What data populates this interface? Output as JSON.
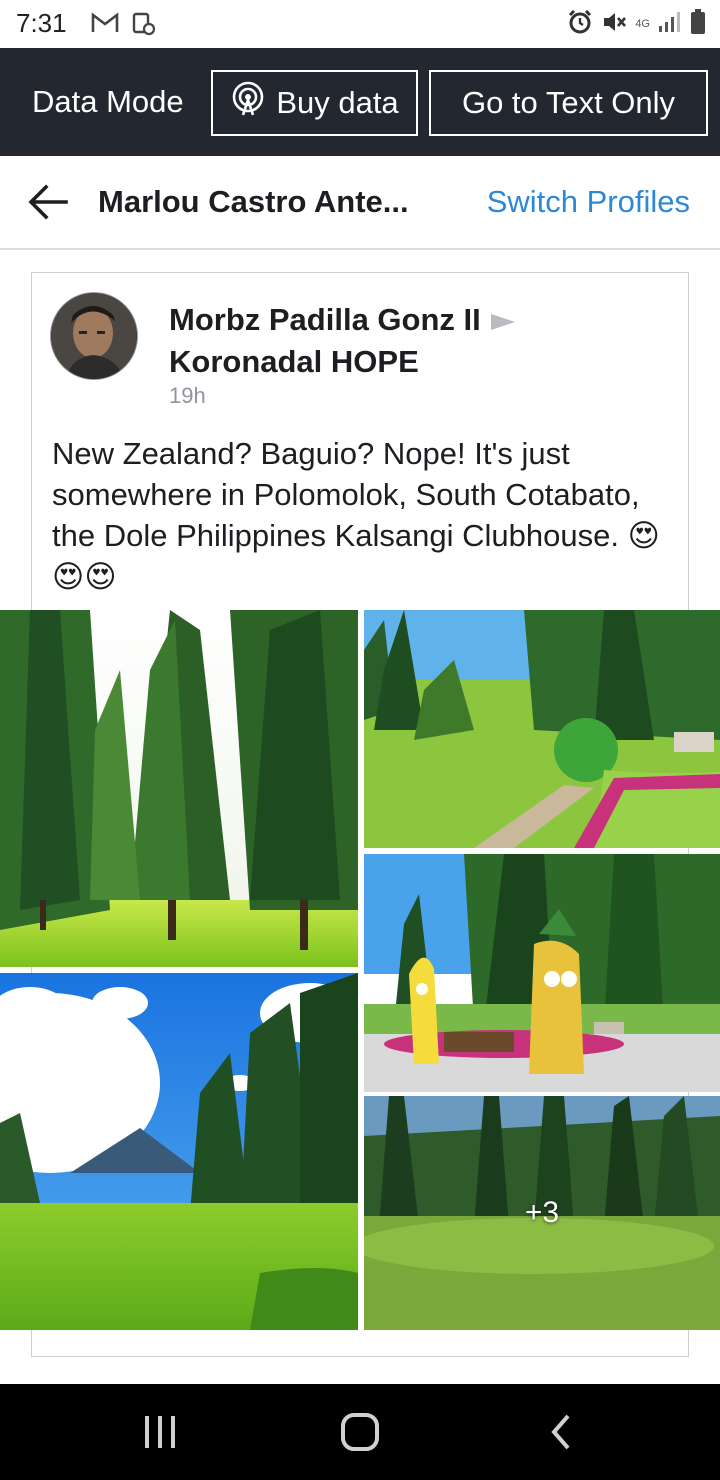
{
  "status": {
    "time": "7:31",
    "network": "4G",
    "icons": [
      "gmail-icon",
      "screenshot-icon",
      "alarm-icon",
      "mute-icon",
      "signal-icon",
      "battery-icon"
    ]
  },
  "data_bar": {
    "mode_label": "Data Mode",
    "buy_label": "Buy data",
    "text_only_label": "Go to Text Only"
  },
  "header": {
    "profile_name": "Marlou Castro Ante...",
    "switch_label": "Switch Profiles"
  },
  "post": {
    "author_line1": "Morbz Padilla Gonz II",
    "author_line2": "Koronadal HOPE",
    "time": "19h",
    "text": "New Zealand? Baguio? Nope! It's just somewhere in Polomolok, South Cotabato, the Dole Philippines Kalsangi Clubhouse. 😍😍😍",
    "more_photos": "+3"
  },
  "colors": {
    "data_bar_bg": "#23272f",
    "link_blue": "#2d88d8",
    "nav_bg": "#000000"
  }
}
